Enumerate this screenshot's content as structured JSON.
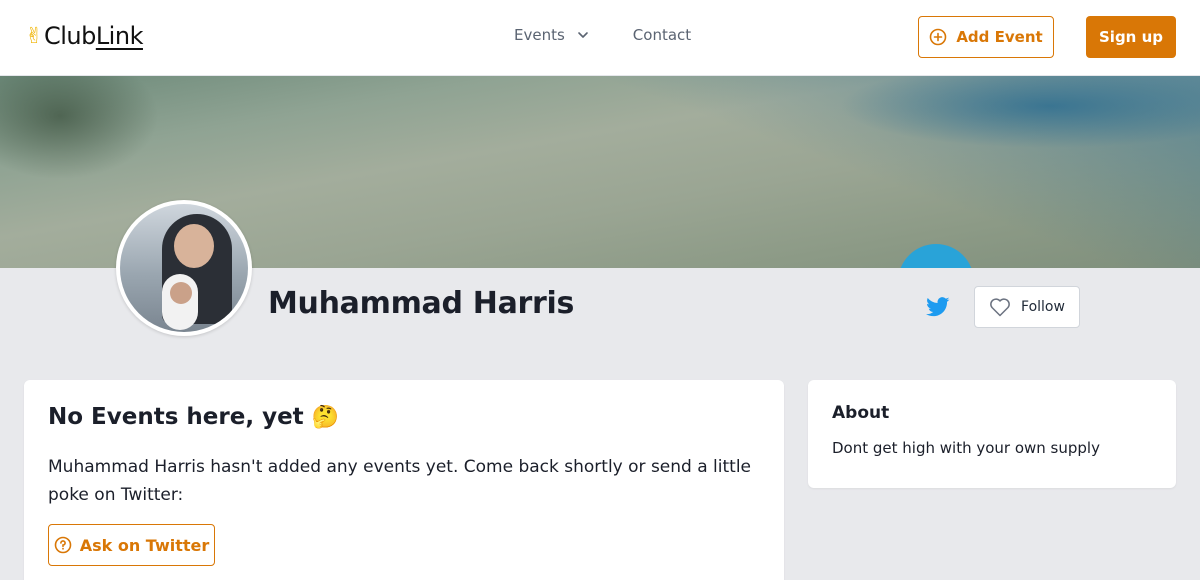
{
  "brand": {
    "logo_hand": "✌",
    "logo_club": "Club",
    "logo_link": "Link"
  },
  "nav": {
    "events_label": "Events",
    "contact_label": "Contact",
    "add_event_label": "Add Event",
    "signup_label": "Sign up"
  },
  "colors": {
    "accent": "#d97706",
    "twitter": "#1d9bf0",
    "page_bg": "#e8e9ec"
  },
  "profile": {
    "name": "Muhammad Harris",
    "follow_label": "Follow"
  },
  "events_card": {
    "title": "No Events here, yet",
    "emoji": "🤔",
    "text": "Muhammad Harris hasn't added any events yet. Come back shortly or send a little poke on Twitter:",
    "ask_label": "Ask on Twitter"
  },
  "about": {
    "title": "About",
    "text": "Dont get high with your own supply"
  },
  "icons": [
    "chevron-down-icon",
    "plus-circle-icon",
    "twitter-icon",
    "heart-icon",
    "question-circle-icon"
  ]
}
